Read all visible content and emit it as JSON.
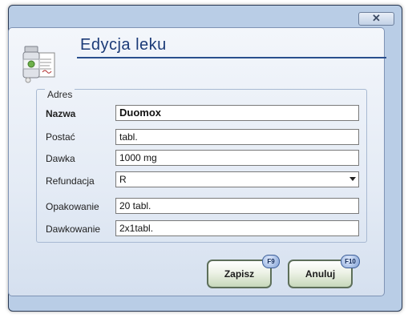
{
  "window": {
    "close_glyph": "✕"
  },
  "header": {
    "title": "Edycja leku",
    "icon": "medicine-document-icon"
  },
  "group": {
    "legend": "Adres"
  },
  "fields": {
    "nazwa": {
      "label": "Nazwa",
      "value": "Duomox"
    },
    "postac": {
      "label": "Postać",
      "value": "tabl."
    },
    "dawka": {
      "label": "Dawka",
      "value": "1000 mg"
    },
    "refundacja": {
      "label": "Refundacja",
      "value": "R"
    },
    "opakowanie": {
      "label": "Opakowanie",
      "value": "20 tabl."
    },
    "dawkowanie": {
      "label": "Dawkowanie",
      "value": "2x1tabl."
    }
  },
  "buttons": {
    "save": {
      "label": "Zapisz",
      "shortcut": "F9"
    },
    "cancel": {
      "label": "Anuluj",
      "shortcut": "F10"
    }
  }
}
